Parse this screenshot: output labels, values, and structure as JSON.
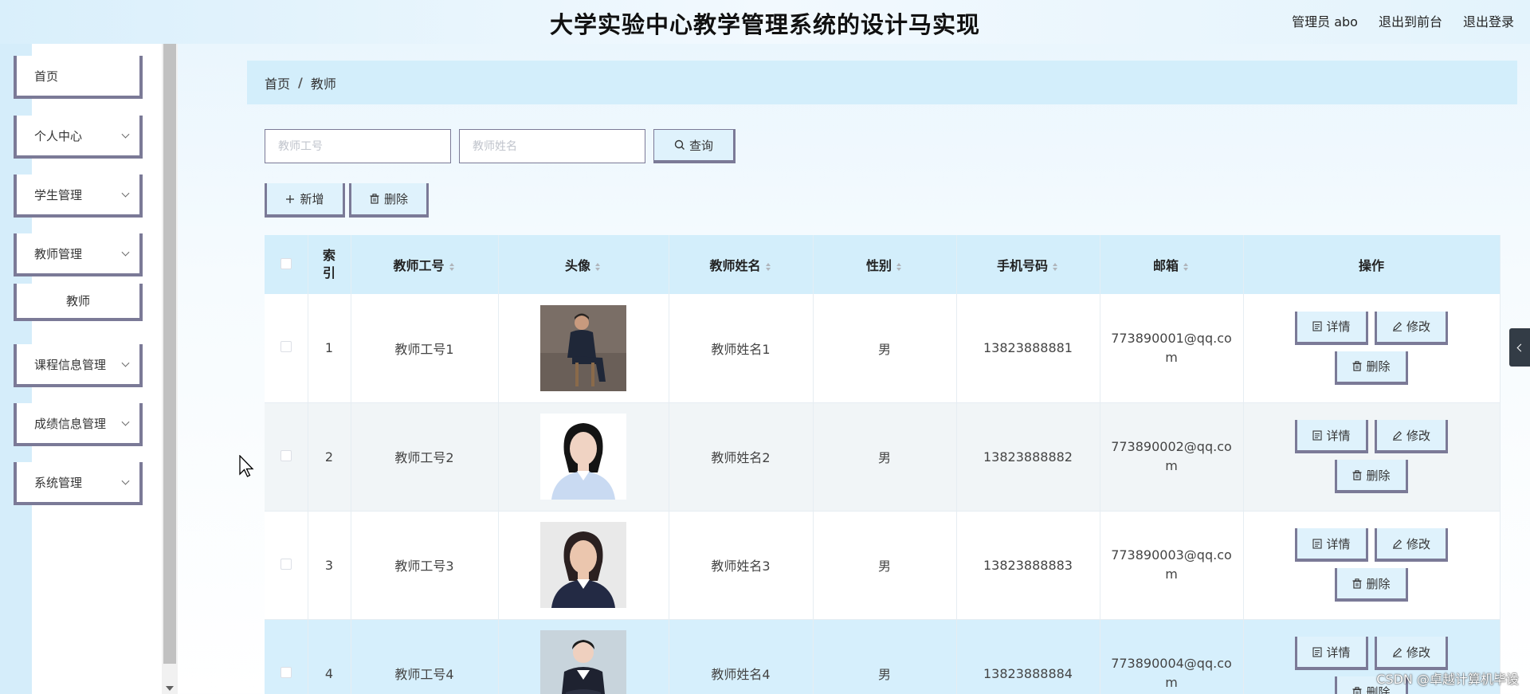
{
  "header": {
    "title": "大学实验中心教学管理系统的设计马实现",
    "role": "管理员 abo",
    "to_front": "退出到前台",
    "logout": "退出登录"
  },
  "sidebar": {
    "items": [
      {
        "label": "首页",
        "expandable": false
      },
      {
        "label": "个人中心",
        "expandable": true
      },
      {
        "label": "学生管理",
        "expandable": true
      },
      {
        "label": "教师管理",
        "expandable": true
      },
      {
        "label": "课程信息管理",
        "expandable": true
      },
      {
        "label": "成绩信息管理",
        "expandable": true
      },
      {
        "label": "系统管理",
        "expandable": true
      }
    ],
    "sub_item": "教师"
  },
  "breadcrumb": {
    "home": "首页",
    "separator": "/",
    "current": "教师"
  },
  "search": {
    "teacher_no_placeholder": "教师工号",
    "teacher_name_placeholder": "教师姓名",
    "query_label": "查询"
  },
  "actions": {
    "add_label": "新增",
    "delete_label": "删除"
  },
  "table": {
    "headers": {
      "index": "索引",
      "teacher_no": "教师工号",
      "avatar": "头像",
      "teacher_name": "教师姓名",
      "gender": "性别",
      "phone": "手机号码",
      "email": "邮箱",
      "ops": "操作"
    },
    "op_labels": {
      "detail": "详情",
      "edit": "修改",
      "delete": "删除"
    },
    "rows": [
      {
        "index": "1",
        "teacher_no": "教师工号1",
        "teacher_name": "教师姓名1",
        "gender": "男",
        "phone": "13823888881",
        "email": "773890001@qq.com"
      },
      {
        "index": "2",
        "teacher_no": "教师工号2",
        "teacher_name": "教师姓名2",
        "gender": "男",
        "phone": "13823888882",
        "email": "773890002@qq.com"
      },
      {
        "index": "3",
        "teacher_no": "教师工号3",
        "teacher_name": "教师姓名3",
        "gender": "男",
        "phone": "13823888883",
        "email": "773890003@qq.com"
      },
      {
        "index": "4",
        "teacher_no": "教师工号4",
        "teacher_name": "教师姓名4",
        "gender": "男",
        "phone": "13823888884",
        "email": "773890004@qq.com"
      }
    ]
  },
  "watermark": "CSDN @卓越计算机毕设",
  "colors": {
    "accent_border": "#7b7a97",
    "header_bg": "#d3eefb",
    "button_bg": "#dff2fc"
  }
}
